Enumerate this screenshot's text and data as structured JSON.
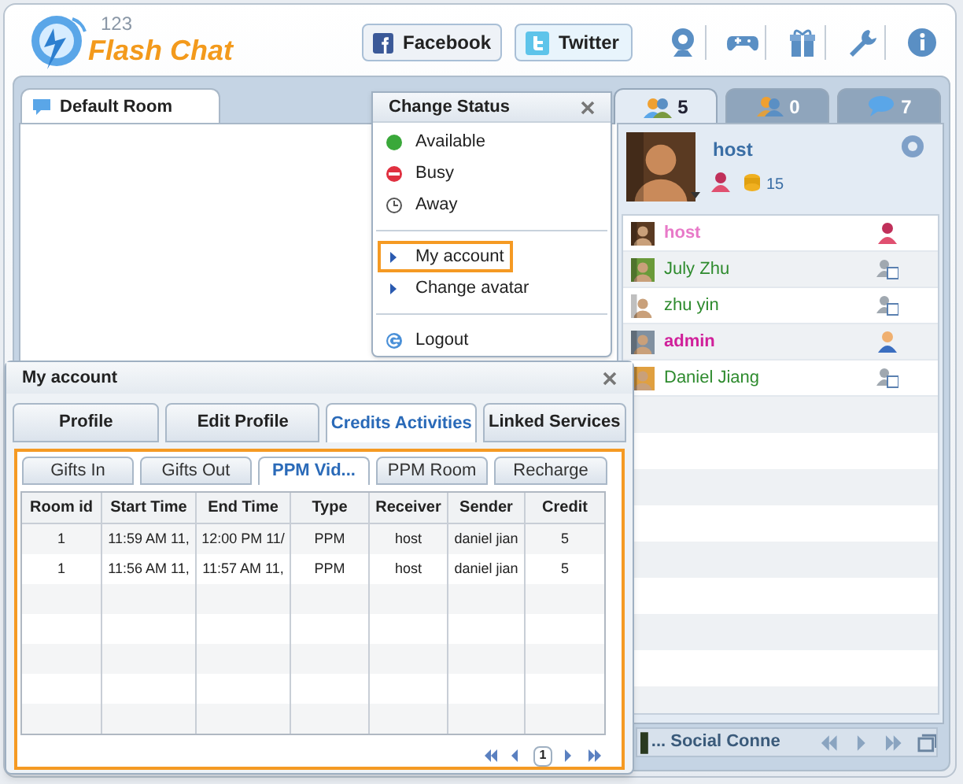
{
  "header": {
    "logo_number": "123",
    "logo_name": "Flash Chat",
    "social_buttons": [
      {
        "label": "Facebook",
        "kind": "facebook"
      },
      {
        "label": "Twitter",
        "kind": "twitter"
      }
    ]
  },
  "room_tab": {
    "label": "Default Room",
    "selected": true
  },
  "side_tabs": [
    {
      "count": "5",
      "kind": "users",
      "selected": true
    },
    {
      "count": "0",
      "kind": "groups",
      "selected": false
    },
    {
      "count": "7",
      "kind": "messages",
      "selected": false
    }
  ],
  "profile": {
    "name": "host",
    "credits": "15"
  },
  "users": [
    {
      "name": "host",
      "color": "#e879c8",
      "kind": "host"
    },
    {
      "name": "July Zhu",
      "color": "#2e8b2e",
      "kind": "user"
    },
    {
      "name": "zhu yin",
      "color": "#2e8b2e",
      "kind": "user"
    },
    {
      "name": "admin",
      "color": "#d0209a",
      "kind": "admin"
    },
    {
      "name": "Daniel Jiang",
      "color": "#2e8b2e",
      "kind": "user"
    }
  ],
  "status_bar": {
    "label": "... Social Conne"
  },
  "status_menu": {
    "title": "Change Status",
    "items": [
      {
        "label": "Available",
        "kind": "available",
        "selected": false
      },
      {
        "label": "Busy",
        "kind": "busy",
        "selected": false
      },
      {
        "label": "Away",
        "kind": "away",
        "selected": false
      },
      {
        "label": "My account",
        "kind": "link",
        "selected": true
      },
      {
        "label": "Change avatar",
        "kind": "link",
        "selected": false
      },
      {
        "label": "Logout",
        "kind": "logout",
        "selected": false
      }
    ]
  },
  "dialog": {
    "title": "My account",
    "tabs": [
      {
        "label": "Profile",
        "selected": false
      },
      {
        "label": "Edit Profile",
        "selected": false
      },
      {
        "label": "Credits Activities",
        "selected": true
      },
      {
        "label": "Linked Services",
        "selected": false
      }
    ],
    "subtabs": [
      {
        "label": "Gifts In",
        "selected": false
      },
      {
        "label": "Gifts Out",
        "selected": false
      },
      {
        "label": "PPM Vid...",
        "selected": true
      },
      {
        "label": "PPM Room",
        "selected": false
      },
      {
        "label": "Recharge",
        "selected": false
      }
    ],
    "table": {
      "columns": [
        "Room id",
        "Start Time",
        "End Time",
        "Type",
        "Receiver",
        "Sender",
        "Credit"
      ],
      "rows": [
        [
          "1",
          "11:59 AM 11,",
          "12:00 PM 11/",
          "PPM",
          "host",
          "daniel jian",
          "5"
        ],
        [
          "1",
          "11:56 AM 11,",
          "11:57 AM 11,",
          "PPM",
          "host",
          "daniel jian",
          "5"
        ]
      ]
    },
    "pager": {
      "page": "1"
    }
  }
}
